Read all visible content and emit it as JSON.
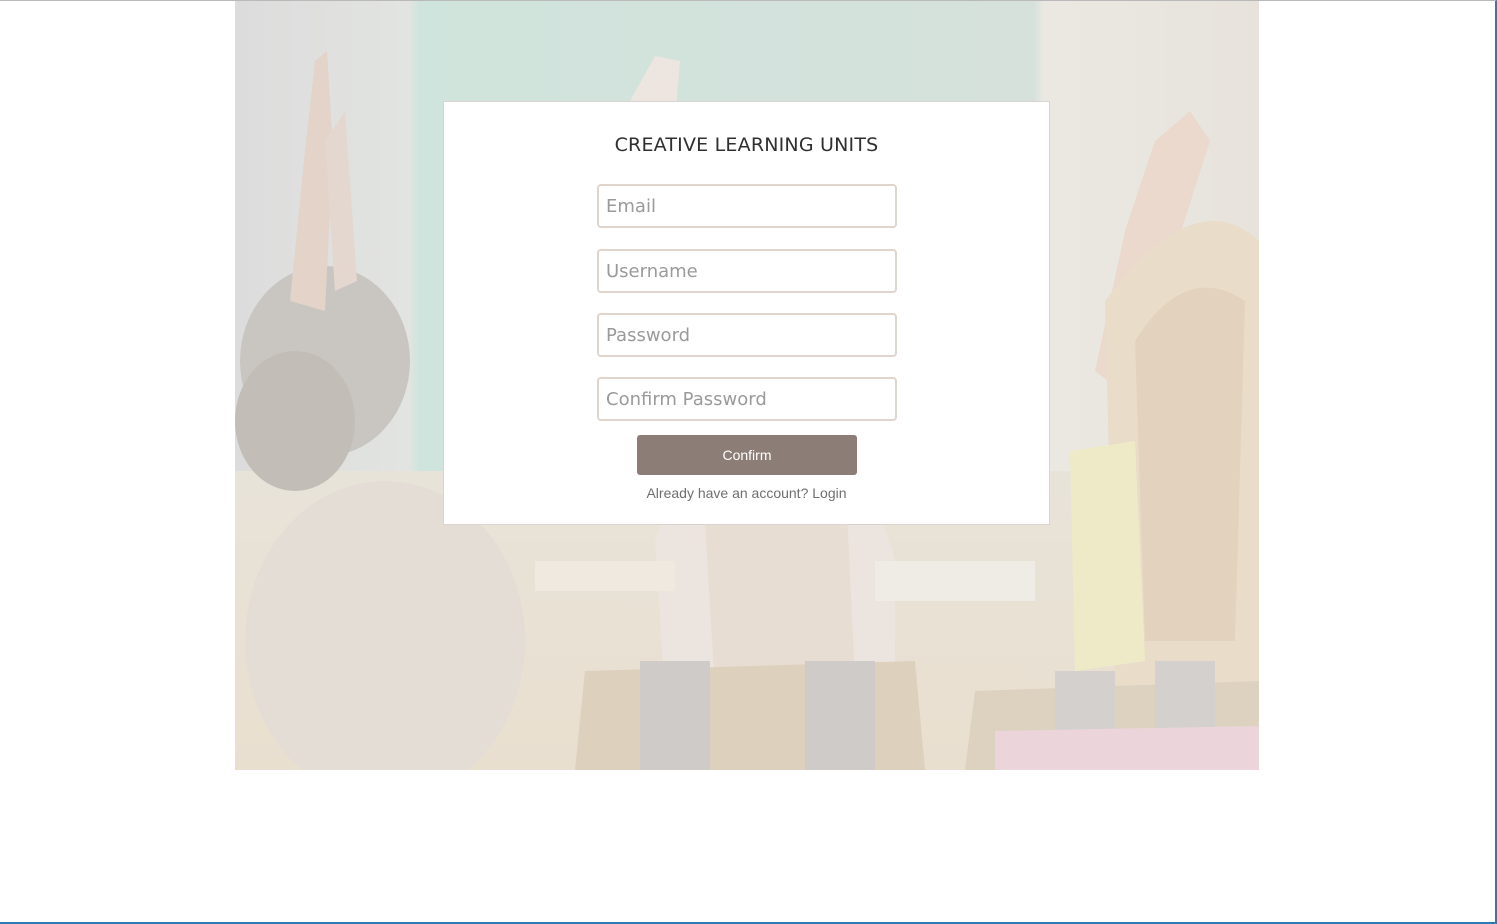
{
  "app": {
    "title": "CREATIVE LEARNING UNITS"
  },
  "form": {
    "email_placeholder": "Email",
    "username_placeholder": "Username",
    "password_placeholder": "Password",
    "confirm_password_placeholder": "Confirm Password",
    "email_value": "",
    "username_value": "",
    "password_value": "",
    "confirm_password_value": "",
    "confirm_label": "Confirm",
    "login_prompt": "Already have an account?",
    "login_link": "Login"
  },
  "colors": {
    "button": "#8c7d76",
    "field_border": "#e0d5cc",
    "frame_border": "#2b7bb9"
  },
  "hero": {
    "image_icon": "classroom-photo"
  }
}
